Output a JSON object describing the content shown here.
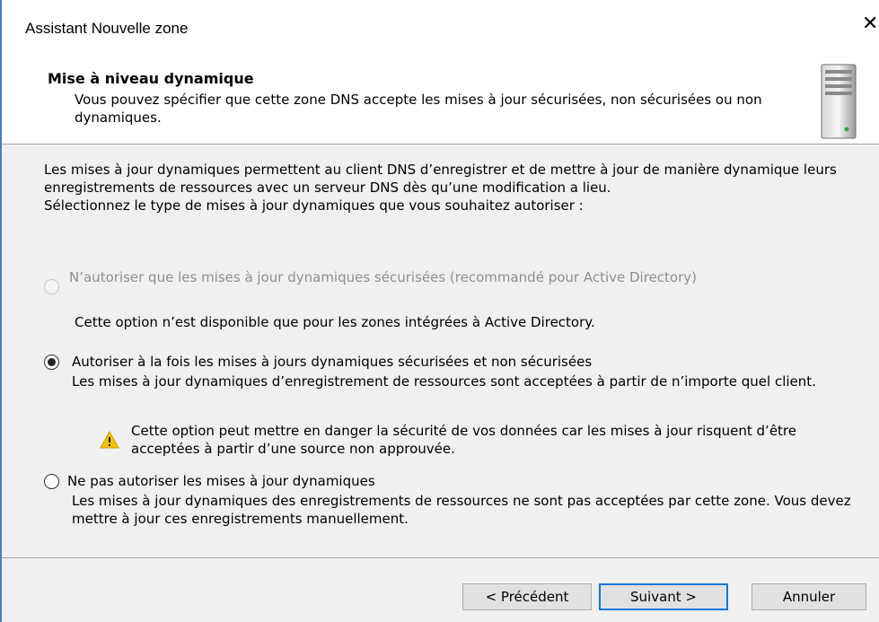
{
  "window": {
    "title": "Assistant Nouvelle zone",
    "close_glyph": "✕"
  },
  "header": {
    "title": "Mise à niveau dynamique",
    "description": "Vous pouvez spécifier que cette zone DNS accepte les mises à jour sécurisées, non sécurisées ou non dynamiques.",
    "icon": "server-icon"
  },
  "intro": {
    "line1": "Les mises à jour dynamiques permettent au client DNS d’enregistrer et de mettre à jour de manière dynamique leurs enregistrements de ressources avec un serveur DNS dès qu’une modification a lieu.",
    "line2": "Sélectionnez le type de mises à jour dynamiques que vous souhaitez autoriser :"
  },
  "options": [
    {
      "label": "N’autoriser que les mises à jour dynamiques sécurisées (recommandé pour Active Directory)",
      "description": "Cette option n’est disponible que pour les zones intégrées à Active Directory.",
      "checked": false,
      "enabled": false
    },
    {
      "label": "Autoriser à la fois les mises à jours dynamiques sécurisées et non sécurisées",
      "description": "Les mises à jour dynamiques d’enregistrement de ressources sont acceptées à partir de n’importe quel client.",
      "warning": "Cette option peut mettre en danger la sécurité de vos données car les mises à jour risquent d’être acceptées à partir d’une source non approuvée.",
      "checked": true,
      "enabled": true
    },
    {
      "label": "Ne pas autoriser les mises à jour dynamiques",
      "description": "Les mises à jour dynamiques des enregistrements de ressources ne sont pas acceptées par cette zone. Vous devez mettre à jour ces enregistrements manuellement.",
      "checked": false,
      "enabled": true
    }
  ],
  "buttons": {
    "back": "< Précédent",
    "next": "Suivant >",
    "cancel": "Annuler"
  },
  "colors": {
    "accent": "#0078d7",
    "warning": "#f5c400"
  }
}
